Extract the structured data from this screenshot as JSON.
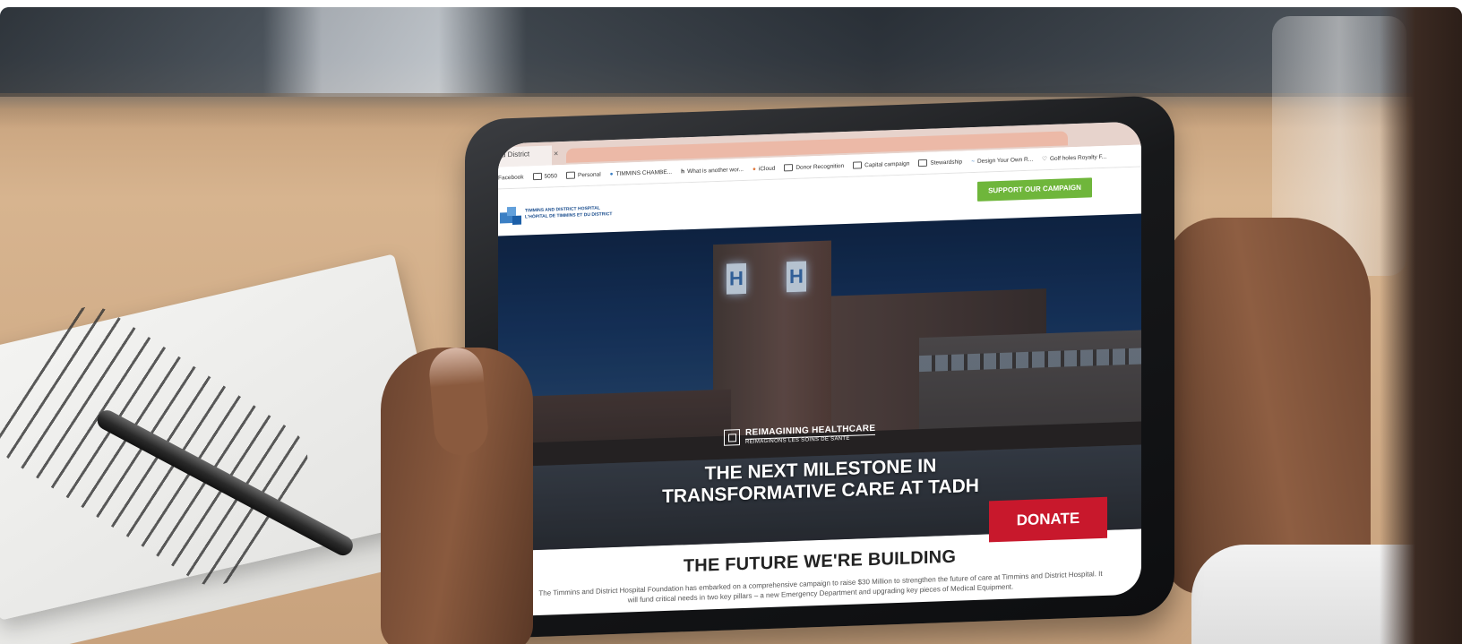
{
  "browser": {
    "tab_title": "d District",
    "tab_close": "×",
    "bookmarks": [
      {
        "label": "Facebook",
        "icon": "none"
      },
      {
        "label": "5050",
        "icon": "folder-icon"
      },
      {
        "label": "Personal",
        "icon": "folder-icon"
      },
      {
        "label": "TIMMINS CHAMBE...",
        "icon": "globe-icon"
      },
      {
        "label": "What is another wor...",
        "icon": "bookmark-icon"
      },
      {
        "label": "iCloud",
        "icon": "cloud-icon"
      },
      {
        "label": "Donor Recognition",
        "icon": "folder-icon"
      },
      {
        "label": "Capital campaign",
        "icon": "folder-icon"
      },
      {
        "label": "Stewardship",
        "icon": "folder-icon"
      },
      {
        "label": "Design Your Own R...",
        "icon": "wave-icon"
      },
      {
        "label": "Golf holes Royalty F...",
        "icon": "heart-icon"
      }
    ]
  },
  "site": {
    "logo_text_line1": "TIMMINS AND DISTRICT HOSPITAL",
    "logo_text_line2": "L'HÔPITAL DE TIMMINS ET DU DISTRICT",
    "cta_label": "SUPPORT OUR CAMPAIGN",
    "hero": {
      "sign_letter": "H",
      "tagline_main": "REIMAGINING  HEALTHCARE",
      "tagline_sub": "RÉIMAGINONS LES SOINS DE SANTÉ",
      "title_line1": "THE NEXT MILESTONE IN",
      "title_line2": "TRANSFORMATIVE CARE AT TADH"
    },
    "donate_label": "DONATE",
    "section_title": "THE FUTURE WE'RE BUILDING",
    "section_body": "The Timmins and District Hospital Foundation has embarked on a comprehensive campaign to raise $30 Million to strengthen the future of care at Timmins and District Hospital. It will fund critical needs in two key pillars – a new Emergency Department and upgrading key pieces of Medical Equipment."
  },
  "colors": {
    "cta_green": "#6fb63b",
    "donate_red": "#c8182c",
    "logo_blue": "#1c4f8f"
  }
}
